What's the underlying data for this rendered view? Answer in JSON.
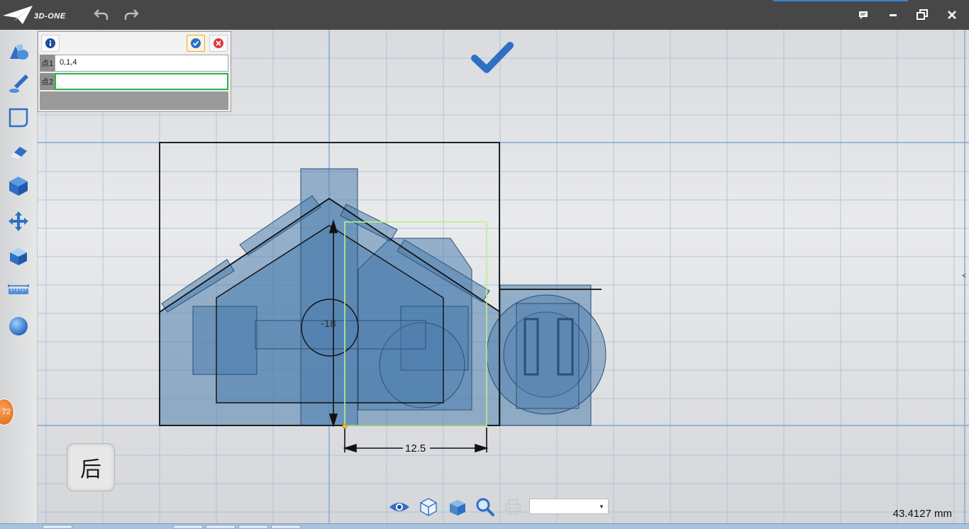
{
  "app": {
    "logo_text": "3D-ONE"
  },
  "titlebar": {
    "undo_icon": "undo-icon",
    "redo_icon": "redo-icon",
    "window_buttons": [
      "chat-icon",
      "minimize-icon",
      "restore-icon",
      "close-icon"
    ]
  },
  "toolbar": {
    "tools": [
      "basic-shapes-icon",
      "sketch-pen-icon",
      "sketch-rectangle-icon",
      "eraser-icon",
      "special-features-icon",
      "move-icon",
      "combine-icon",
      "measure-icon",
      "material-sphere-icon"
    ],
    "badge": "72"
  },
  "input_panel": {
    "info_icon": "info-icon",
    "ok_icon": "check-icon",
    "cancel_icon": "cancel-icon",
    "rows": [
      {
        "label": "点1",
        "value": "0,1,4"
      },
      {
        "label": "点2",
        "value": ""
      }
    ]
  },
  "canvas": {
    "confirm_icon": "big-check-icon",
    "vertical_dimension": "-18",
    "horizontal_dimension": "12.5"
  },
  "view": {
    "label": "后"
  },
  "bottombar": {
    "icons": [
      "eye-icon",
      "view-cube-icon",
      "shaded-box-icon",
      "zoom-icon",
      "print-icon"
    ],
    "dropdown_value": ""
  },
  "status": {
    "distance": "43.4127 mm"
  },
  "colors": {
    "accent": "#2f6fc4",
    "titlebar": "#474747",
    "ok_green": "#2bb548",
    "badge": "#e87a2c"
  }
}
